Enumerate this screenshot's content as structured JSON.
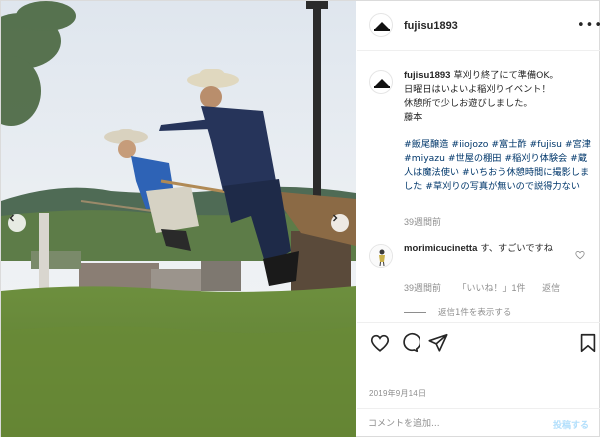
{
  "post": {
    "username": "fujisu1893",
    "more_label": "•••",
    "caption": {
      "username": "fujisu1893",
      "text_lines": [
        "草刈り終了にて準備OK。",
        "日曜日はいよいよ稲刈りイベント！",
        "休憩所で少しお遊びしました。",
        "藤本"
      ],
      "hashtags": "#飯尾醸造 #iiojozo #富士酢 #fujisu #宮津 #miyazu #世屋の棚田 #稲刈り体験会 #蔵人は魔法使い #いちおう休憩時間に撮影しました #草刈りの写真が無いので説得力ない",
      "time": "39週間前"
    },
    "comment": {
      "username": "morimicucinetta",
      "text": "す、すごいですね",
      "time": "39週間前",
      "likes": "「いいね！」1件",
      "reply_label": "返信",
      "view_replies": "返信1件を表示する"
    },
    "date": "2019年9月14日",
    "add_comment": {
      "placeholder": "コメントを追加...",
      "post_label": "投稿する"
    }
  }
}
